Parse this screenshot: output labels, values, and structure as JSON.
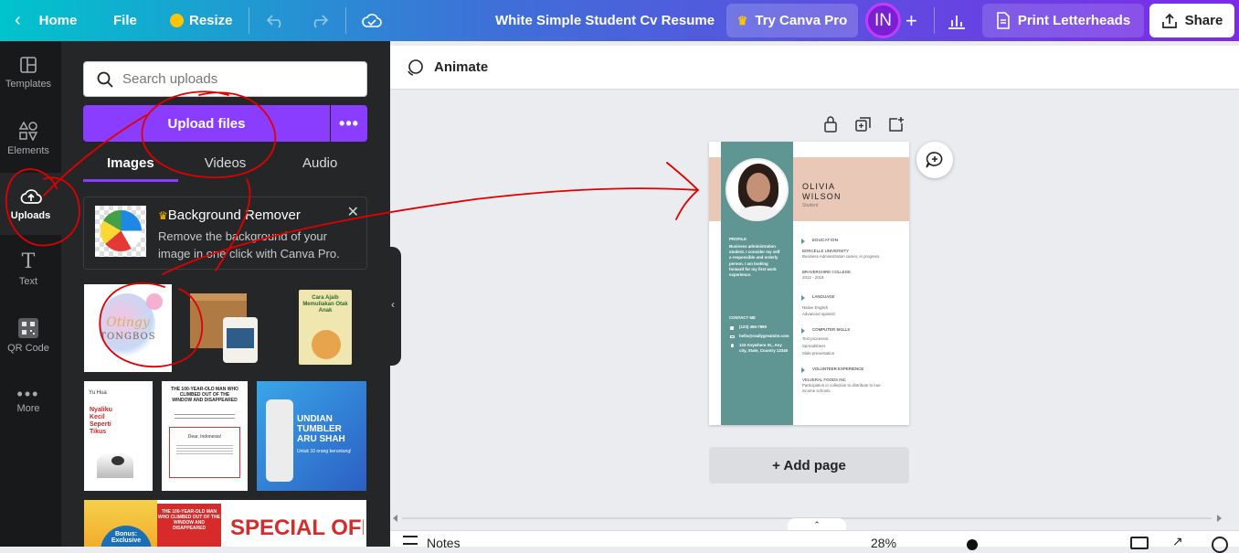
{
  "topbar": {
    "home": "Home",
    "file": "File",
    "resize": "Resize",
    "doc_title": "White Simple Student Cv Resume",
    "try_pro": "Try Canva Pro",
    "avatar": "IN",
    "print": "Print Letterheads",
    "share": "Share"
  },
  "rail": {
    "templates": "Templates",
    "elements": "Elements",
    "uploads": "Uploads",
    "text": "Text",
    "qrcode": "QR Code",
    "more": "More"
  },
  "panel": {
    "search_placeholder": "Search uploads",
    "upload_files": "Upload files",
    "tabs": [
      "Images",
      "Videos",
      "Audio"
    ],
    "promo_title": "Background Remover",
    "promo_text": "Remove the background of your image in one click with Canva Pro.",
    "thumb1_script": "Otingy",
    "thumb1_word": "TONGBOS",
    "thumb3_title": "Cara Ajaib Memuliakan Otak Anak",
    "thumb4_author": "Yu Hua",
    "thumb4_title": "Nyaliku Kecil Seperti Tikus",
    "thumb5_title": "THE 100-YEAR-OLD MAN WHO CLIMBED OUT OF THE WINDOW AND DISAPPEARED",
    "thumb5_greeting": "Dear, Indonesia!",
    "thumb6_title": "UNDIAN TUMBLER ARU SHAH",
    "thumb6_sub": "Untuk 10 orang beruntung!",
    "thumb7_badge": "Bonus: Exclusive",
    "thumb7_book": "THE 100-YEAR-OLD MAN WHO CLIMBED OUT OF THE WINDOW AND DISAPPEARED",
    "thumb7_special": "SPECIAL OFFER"
  },
  "canvas": {
    "animate": "Animate",
    "add_page": "+ Add page",
    "notes": "Notes",
    "zoom": "28%"
  },
  "resume": {
    "first_name": "OLIVIA",
    "last_name": "WILSON",
    "role": "Student",
    "profile_h": "PROFILE",
    "profile_text": "Business administration student. I consider my self a responsible and orderly person. I am looking forward for my first work experience.",
    "contact_h": "CONTACT ME",
    "phone": "(123) 456-7890",
    "email": "hello@reallygreatsite.com",
    "address": "123 Anywhere St., Any city, State, Country 12345",
    "education_h": "EDUCATION",
    "edu1": "BORCELLE UNIVERSITY",
    "edu1_d": "Business Administration career, in progress.",
    "edu2": "BRAVERSHIRE COLLEGE",
    "edu2_d": "2012 - 2019",
    "language_h": "LANGUAGE",
    "lang1": "Native English",
    "lang2": "Advanced spanish",
    "skills_h": "COMPUTER SKILLS",
    "skill1": "Text processor.",
    "skill2": "Spreadsheet.",
    "skill3": "Slide presentation",
    "volunteer_h": "VOLUNTEER EXPERIENCE",
    "vol1": "VELVERAL FOODS INC",
    "vol1_d": "Participation in collection to distribute to low-income schools."
  },
  "colors": {
    "teal": "#5f9694",
    "peach": "#e9c8b8",
    "purple": "#8b3dff",
    "annotation": "#e00000"
  }
}
